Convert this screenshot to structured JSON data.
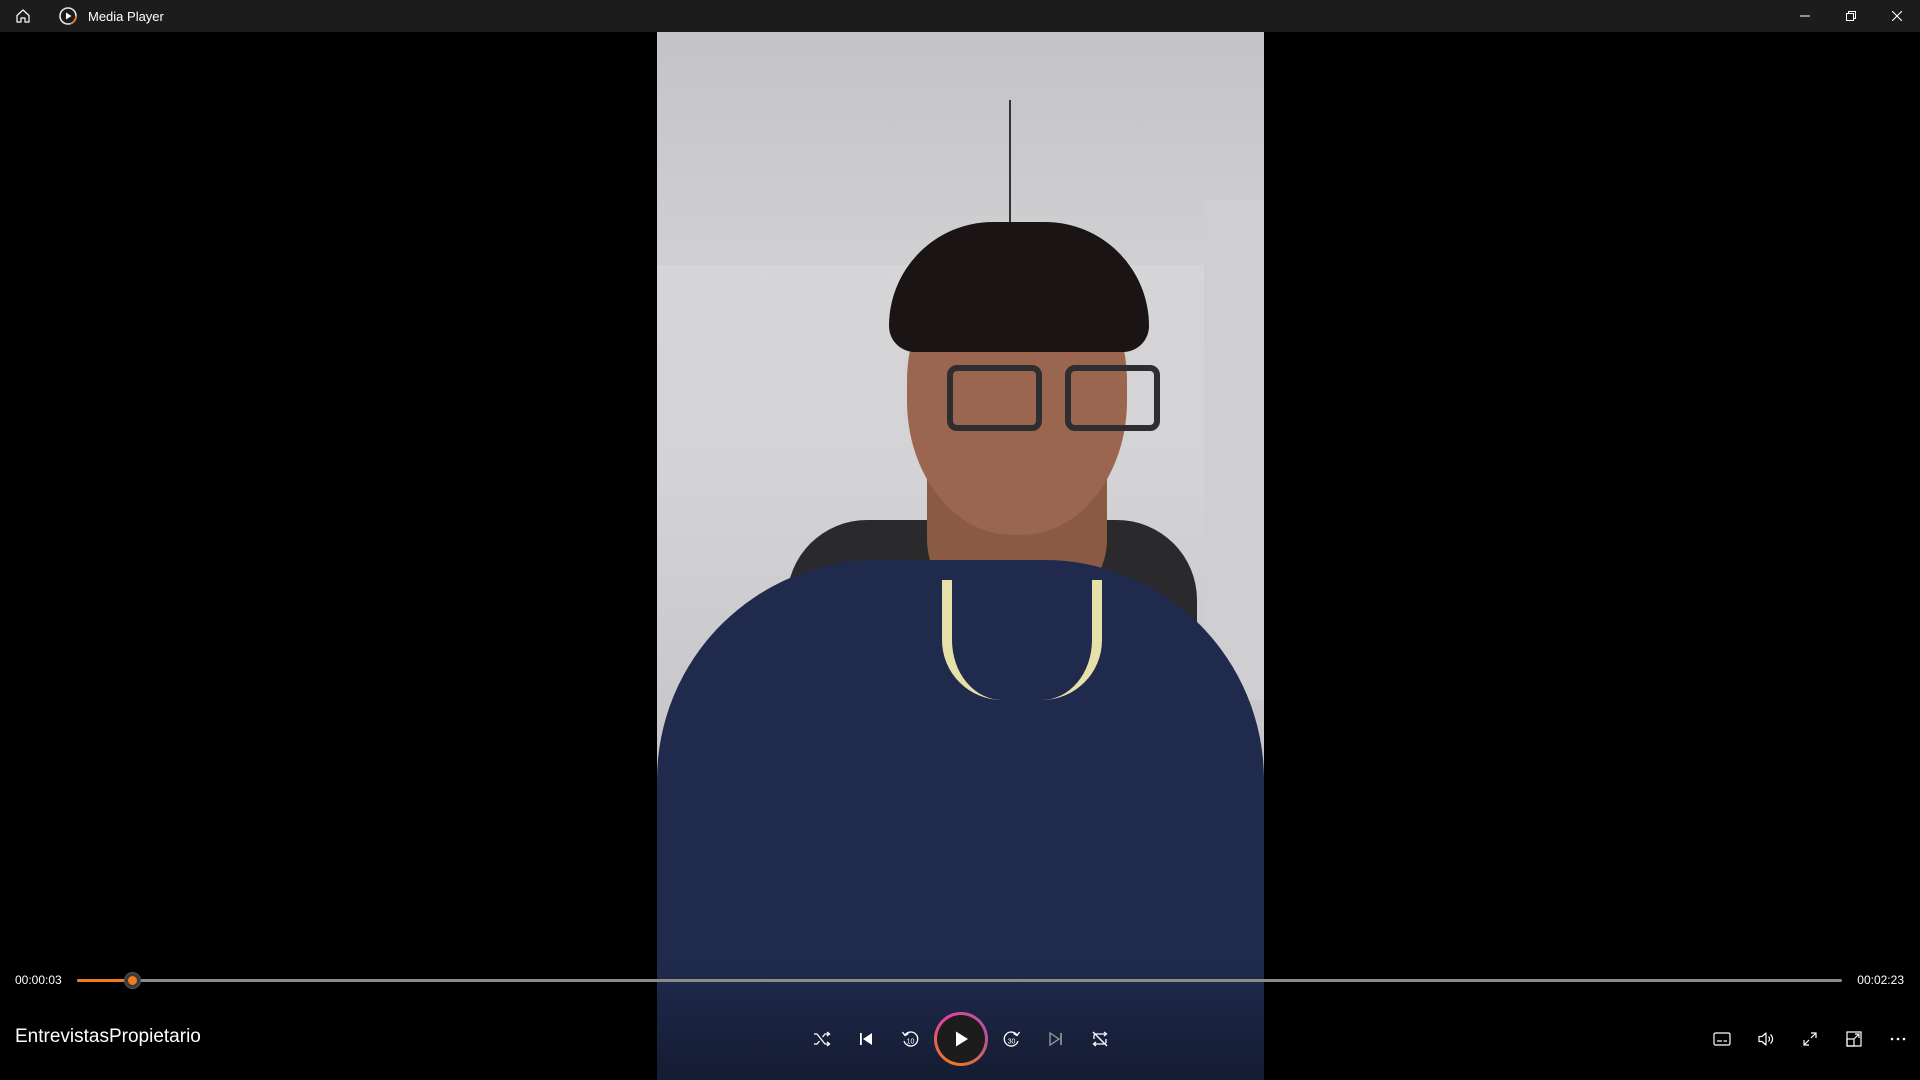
{
  "window": {
    "title": "Media Player"
  },
  "player": {
    "media_title": "EntrevistasPropietario",
    "current_time": "00:00:03",
    "total_time": "00:02:23",
    "progress_fraction": 0.031,
    "accent_color": "#f07a1e"
  },
  "icons": {
    "home": "home-icon",
    "app": "media-player-icon",
    "minimize": "minimize-icon",
    "restore": "restore-icon",
    "close": "close-icon",
    "shuffle": "shuffle-icon",
    "previous": "previous-icon",
    "rewind": "rewind-10-icon",
    "play": "play-icon",
    "forward": "forward-30-icon",
    "next": "next-icon",
    "repeat": "repeat-off-icon",
    "captions": "captions-icon",
    "volume": "volume-icon",
    "fullscreen": "fullscreen-icon",
    "miniplayer": "miniplayer-icon",
    "more": "more-icon"
  },
  "labels": {
    "rewind_seconds": "10",
    "forward_seconds": "30"
  }
}
